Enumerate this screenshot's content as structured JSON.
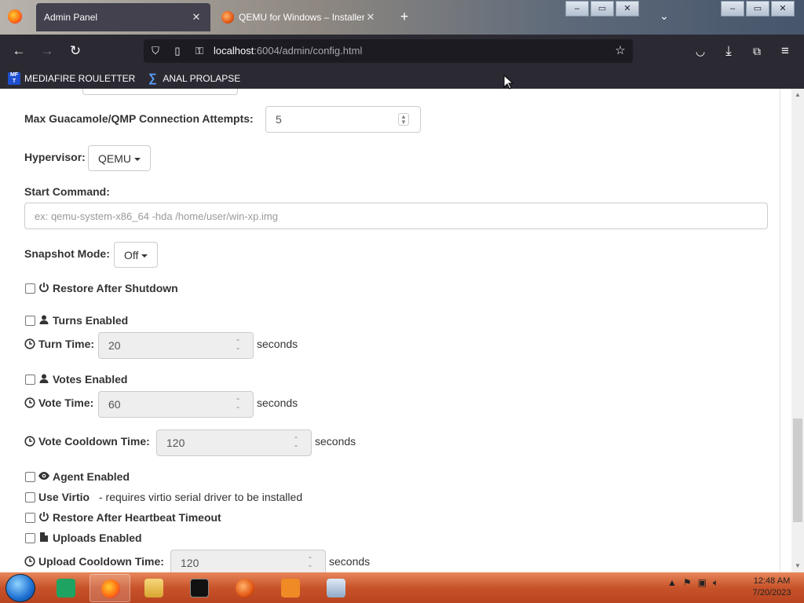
{
  "browser": {
    "tabs": [
      {
        "title": "Admin Panel",
        "active": true
      },
      {
        "title": "QEMU for Windows – Installers",
        "active": false
      }
    ],
    "url_host": "localhost",
    "url_rest": ":6004/admin/config.html",
    "bookmarks": [
      {
        "label": "MEDIAFIRE ROULETTER",
        "icon": "mediafire-icon"
      },
      {
        "label": "ANAL PROLAPSE",
        "icon": "sigma-icon"
      }
    ]
  },
  "form": {
    "max_attempts_label": "Max Guacamole/QMP Connection Attempts:",
    "max_attempts_value": "5",
    "hypervisor_label": "Hypervisor:",
    "hypervisor_value": "QEMU",
    "start_command_label": "Start Command:",
    "start_command_placeholder": "ex: qemu-system-x86_64 -hda /home/user/win-xp.img",
    "snapshot_label": "Snapshot Mode:",
    "snapshot_value": "Off",
    "restore_shutdown_label": "Restore After Shutdown",
    "turns_enabled_label": "Turns Enabled",
    "turn_time_label": "Turn Time:",
    "turn_time_value": "20",
    "votes_enabled_label": "Votes Enabled",
    "vote_time_label": "Vote Time:",
    "vote_time_value": "60",
    "vote_cooldown_label": "Vote Cooldown Time:",
    "vote_cooldown_value": "120",
    "agent_enabled_label": "Agent Enabled",
    "use_virtio_label": "Use Virtio",
    "use_virtio_note": "- requires virtio serial driver to be installed",
    "restore_heartbeat_label": "Restore After Heartbeat Timeout",
    "uploads_enabled_label": "Uploads Enabled",
    "upload_cooldown_label": "Upload Cooldown Time:",
    "upload_cooldown_value": "120",
    "seconds_unit": "seconds"
  },
  "taskbar": {
    "time": "12:48 AM",
    "date": "7/20/2023"
  }
}
